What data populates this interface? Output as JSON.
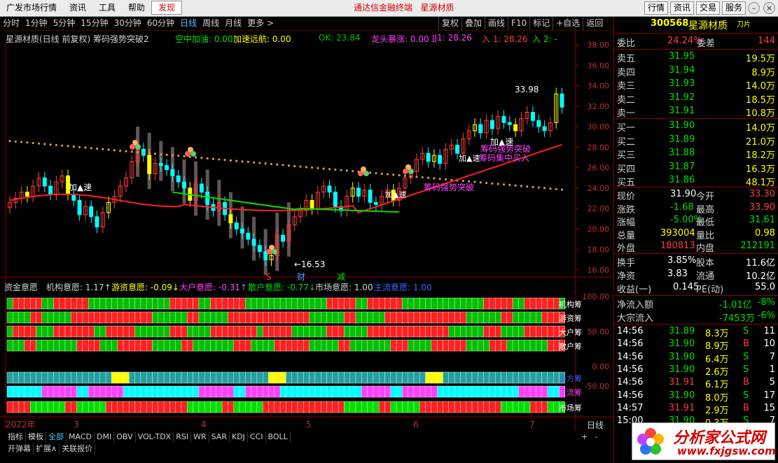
{
  "menubar": {
    "items": [
      "广发市场行情",
      "资讯",
      "工具",
      "帮助",
      "发现"
    ],
    "center_left": "通达信金融终端",
    "center_right": "星源材质",
    "right_buttons": [
      "行情",
      "资讯",
      "交易",
      "服务"
    ]
  },
  "toolbar": {
    "periods": [
      "分时",
      "1分钟",
      "5分钟",
      "15分钟",
      "30分钟",
      "60分钟",
      "日线",
      "周线",
      "月线",
      "更多 >"
    ],
    "selected": "日线",
    "actions": [
      "复权",
      "叠加",
      "画线",
      "F10",
      "标记",
      "+自选",
      "返回"
    ]
  },
  "legend": {
    "title": "星源材质(日线 前复权) 筹码强势突破2",
    "kongzhong": "空中加油: 0.00",
    "jiasu": "加速远航: 0.00",
    "ok": "OK: 23.84",
    "longtou": "龙头暴涨: 0.00",
    "jj1": "JJ1: 28.26",
    "ru1": "入 1: 28.26",
    "ru2": "入 2: -"
  },
  "chart_data": {
    "type": "candlestick",
    "y_axis": [
      38.0,
      36.0,
      34.0,
      32.0,
      30.0,
      28.0,
      26.0,
      24.0,
      22.0,
      20.0,
      18.0,
      16.0
    ],
    "annotations": {
      "high": "33.98",
      "low": "16.53",
      "jia_su_1": "加▲速",
      "jia_su_2": "加▲速",
      "jia_su_3": "加▲速",
      "jia_su_4": "加▲速",
      "chouma1": "筹码强势突破",
      "chouma2": "筹码集中买入",
      "chouma3": "筹码强势突破",
      "markers": [
        "S",
        "财",
        "减"
      ]
    },
    "x_labels": [
      "2022年",
      "3",
      "4",
      "5",
      "6",
      "7"
    ],
    "period_label": "日线",
    "indicator": {
      "title": "资金意愿",
      "jigou": "机构意愿: 1.17↑",
      "youzi": "游资意愿: -0.09↓",
      "dahu": "大户意愿: -0.31↑",
      "sanhu": "散户意愿: -0.77↓",
      "shichang": "市场意愿: 1.00",
      "zhuliu": "主流意愿: 1.00",
      "y_axis": [
        "100.00",
        "50.00",
        "0.00",
        "-50.00"
      ],
      "row_labels": [
        "机构筹",
        "游资筹",
        "大户筹",
        "散户筹",
        "多方筹",
        "主流筹",
        "市场筹"
      ]
    }
  },
  "bottom": {
    "tabs": [
      "指标",
      "模板",
      "全部",
      "MACD",
      "DMI",
      "OBV",
      "VOL-TDX",
      "RSI",
      "WR",
      "SAR",
      "KDJ",
      "CCI",
      "BOLL"
    ],
    "selected": "全部",
    "tabs2": [
      "开弹幕",
      "扩展∧",
      "关联报价"
    ]
  },
  "quote": {
    "code": "300568",
    "name": "星源材质",
    "weibi_label": "委比",
    "weibi": "24.24%",
    "weicha_label": "委差",
    "weicha": "144",
    "sell": [
      {
        "label": "卖五",
        "price": "31.95",
        "vol": "19.5万"
      },
      {
        "label": "卖四",
        "price": "31.94",
        "vol": "8.9万"
      },
      {
        "label": "卖三",
        "price": "31.93",
        "vol": "14.0万"
      },
      {
        "label": "卖二",
        "price": "31.92",
        "vol": "18.5万"
      },
      {
        "label": "卖一",
        "price": "31.91",
        "vol": "10.8万"
      }
    ],
    "buy": [
      {
        "label": "买一",
        "price": "31.90",
        "vol": "14.0万"
      },
      {
        "label": "买二",
        "price": "31.89",
        "vol": "21.0万"
      },
      {
        "label": "买三",
        "price": "31.88",
        "vol": "18.2万"
      },
      {
        "label": "买四",
        "price": "31.87",
        "vol": "16.3万"
      },
      {
        "label": "买五",
        "price": "31.86",
        "vol": "48.1万"
      }
    ],
    "stats1": [
      [
        "现价",
        "31.90",
        "今开",
        "33.30"
      ],
      [
        "涨跌",
        "-1.68",
        "最高",
        "33.90"
      ],
      [
        "涨幅",
        "-5.00%",
        "最低",
        "31.61"
      ],
      [
        "总量",
        "393004",
        "量比",
        "0.98"
      ],
      [
        "外盘",
        "180813",
        "内盘",
        "212191"
      ]
    ],
    "stats2": [
      [
        "换手",
        "3.85%",
        "股本",
        "11.6亿"
      ],
      [
        "净资",
        "3.83",
        "流通",
        "10.2亿"
      ],
      [
        "收益(一)",
        "0.145",
        "PE(动)",
        "55.0"
      ]
    ],
    "flow": [
      [
        "净流入额",
        "-1.01亿",
        "-8%"
      ],
      [
        "大宗流入",
        "-7453万",
        "-6%"
      ]
    ],
    "ticks": [
      [
        "14:56",
        "31.89",
        "8.3万",
        "S"
      ],
      [
        "14:56",
        "31.90",
        "8.9万",
        "B"
      ],
      [
        "14:56",
        "31.90",
        "6.4万",
        "S"
      ],
      [
        "14:56",
        "31.90",
        "2.6万",
        "S"
      ],
      [
        "14:56",
        "31.91",
        "6.1万",
        "B"
      ],
      [
        "14:56",
        "31.90",
        "8.0万",
        "S"
      ],
      [
        "14:57",
        "31.91",
        "2.9万",
        "B"
      ],
      [
        "15:00",
        "31.90",
        "0.3万",
        "S"
      ]
    ],
    "tick_count": [
      "11",
      "10",
      "7",
      "1",
      "5",
      "17",
      "15",
      "7"
    ]
  },
  "watermark": {
    "title": "分析家公式网",
    "url": "www.fxjgsw.com"
  },
  "colors": {
    "red": "#ff3c3c",
    "green": "#00e000",
    "yellow": "#ffff00",
    "cyan": "#00ffff",
    "magenta": "#ff40ff",
    "gold": "#d4a400"
  }
}
